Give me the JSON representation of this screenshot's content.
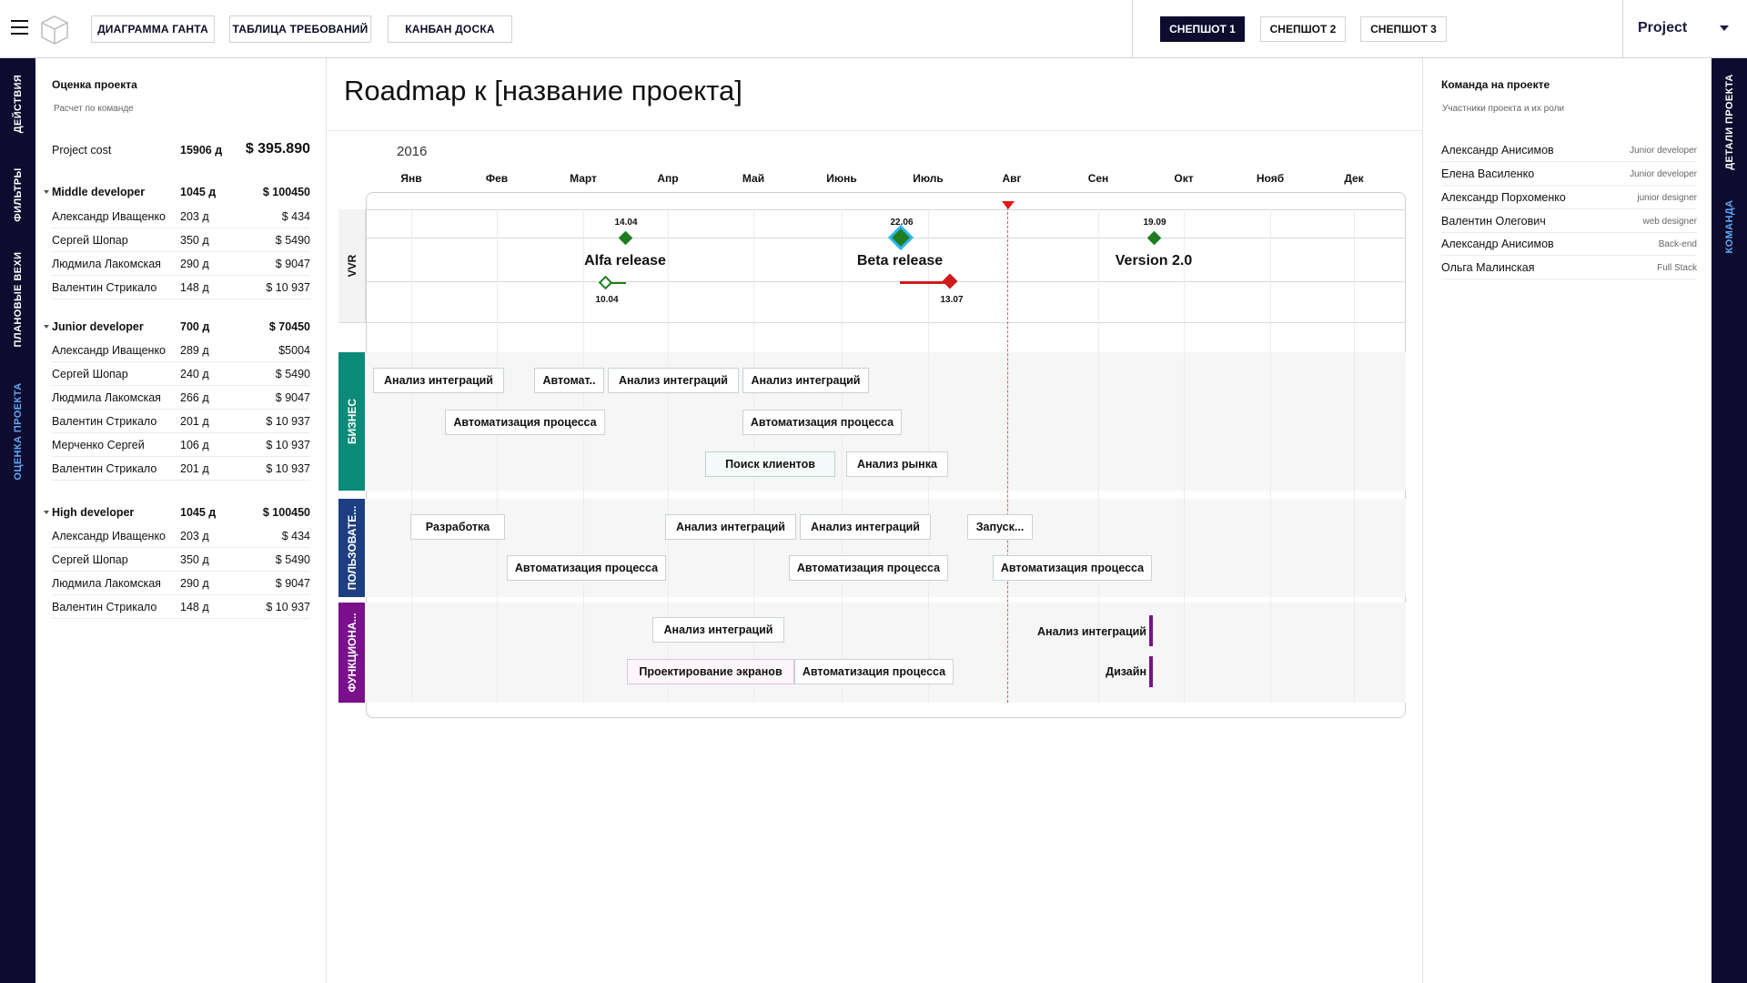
{
  "nav": {
    "tabs": [
      "ДИАГРАММА ГАНТА",
      "ТАБЛИЦА ТРЕБОВАНИЙ",
      "КАНБАН ДОСКА"
    ],
    "snapshots": [
      "СНЕПШОТ  1",
      "СНЕПШОТ  2",
      "СНЕПШОТ  3"
    ],
    "active_snapshot": 0,
    "project_select": "Project"
  },
  "left_nav": [
    "ДЕЙСТВИЯ",
    "ФИЛЬТРЫ",
    "ПЛАНОВЫЕ ВЕХИ",
    "ОЦЕНКА ПРОЕКТА"
  ],
  "right_nav": [
    "ДЕТАЛИ ПРОЕКТА",
    "КОМАНДА"
  ],
  "estimate": {
    "title": "Оценка проекта",
    "subtitle": "Расчет по команде",
    "total": {
      "label": "Project cost",
      "days": "15906 д",
      "cost": "$ 395.890"
    },
    "groups": [
      {
        "name": "Middle developer",
        "days": "1045 д",
        "cost": "$ 100450",
        "members": [
          {
            "name": "Александр Иващенко",
            "days": "203 д",
            "cost": "$ 434"
          },
          {
            "name": "Сергей Шопар",
            "days": "350 д",
            "cost": "$ 5490"
          },
          {
            "name": "Людмила Лакомская",
            "days": "290 д",
            "cost": "$ 9047"
          },
          {
            "name": "Валентин Стрикало",
            "days": "148 д",
            "cost": "$ 10 937"
          }
        ]
      },
      {
        "name": "Junior developer",
        "days": "700 д",
        "cost": "$ 70450",
        "members": [
          {
            "name": "Александр Иващенко",
            "days": "289 д",
            "cost": "$5004"
          },
          {
            "name": "Сергей Шопар",
            "days": "240 д",
            "cost": "$ 5490"
          },
          {
            "name": "Людмила Лакомская",
            "days": "266 д",
            "cost": "$ 9047"
          },
          {
            "name": "Валентин Стрикало",
            "days": "201 д",
            "cost": "$ 10 937"
          },
          {
            "name": "Мерченко Сергей",
            "days": "106 д",
            "cost": "$ 10 937"
          },
          {
            "name": "Валентин Стрикало",
            "days": "201 д",
            "cost": "$ 10 937"
          }
        ]
      },
      {
        "name": "High developer",
        "days": "1045 д",
        "cost": "$ 100450",
        "members": [
          {
            "name": "Александр Иващенко",
            "days": "203 д",
            "cost": "$ 434"
          },
          {
            "name": "Сергей Шопар",
            "days": "350 д",
            "cost": "$ 5490"
          },
          {
            "name": "Людмила Лакомская",
            "days": "290 д",
            "cost": "$ 9047"
          },
          {
            "name": "Валентин Стрикало",
            "days": "148 д",
            "cost": "$ 10 937"
          }
        ]
      }
    ]
  },
  "roadmap": {
    "title": "Roadmap к [название проекта]",
    "year": "2016",
    "months": [
      "Янв",
      "Фев",
      "Март",
      "Апр",
      "Май",
      "Июнь",
      "Июль",
      "Авг",
      "Сен",
      "Окт",
      "Нояб",
      "Дек"
    ],
    "vvr_label": "VVR",
    "milestones": [
      {
        "name": "Alfa release",
        "planned": "14.04",
        "actual": "10.04",
        "status": "early"
      },
      {
        "name": "Beta release",
        "planned": "22.06",
        "actual": "13.07",
        "status": "late"
      },
      {
        "name": "Version 2.0",
        "planned": "19.09",
        "actual": "",
        "status": "planned"
      }
    ],
    "lanes": [
      {
        "name": "БИЗНЕС",
        "color": "#0a8a78",
        "tasks": [
          "Анализ интеграций",
          "Автомат..",
          "Анализ интеграций",
          "Анализ интеграций",
          "Автоматизация процесса",
          "Автоматизация процесса",
          "Поиск клиентов",
          "Анализ рынка"
        ]
      },
      {
        "name": "ПОЛЬЗОВАТЕ...",
        "color": "#1d3f82",
        "tasks": [
          "Разработка",
          "Анализ интеграций",
          "Анализ интеграций",
          "Запуск...",
          "Автоматизация процесса",
          "Автоматизация процесса",
          "Автоматизация процесса"
        ]
      },
      {
        "name": "ФУНКЦИОНА...",
        "color": "#7a108c",
        "tasks": [
          "Анализ интеграций",
          "Проектирование экранов",
          "Автоматизация процесса"
        ],
        "end_markers": [
          "Анализ интеграций",
          "Дизайн"
        ]
      }
    ]
  },
  "team": {
    "title": "Команда на проекте",
    "subtitle": "Участники проекта и их роли",
    "members": [
      {
        "name": "Александр Анисимов",
        "role": "Junior developer"
      },
      {
        "name": "Елена Василенко",
        "role": "Junior developer"
      },
      {
        "name": "Александр Порхоменко",
        "role": "junior designer"
      },
      {
        "name": "Валентин Олегович",
        "role": "web designer"
      },
      {
        "name": "Александр Анисимов",
        "role": "Back-end"
      },
      {
        "name": "Ольга Малинская",
        "role": "Full Stack"
      }
    ]
  },
  "colors": {
    "nav_bg": "#0d0c2e",
    "active_tab": "#5fa8f7",
    "on_time": "#1e7d1e",
    "late": "#d11a1a",
    "today": "#e01818"
  }
}
